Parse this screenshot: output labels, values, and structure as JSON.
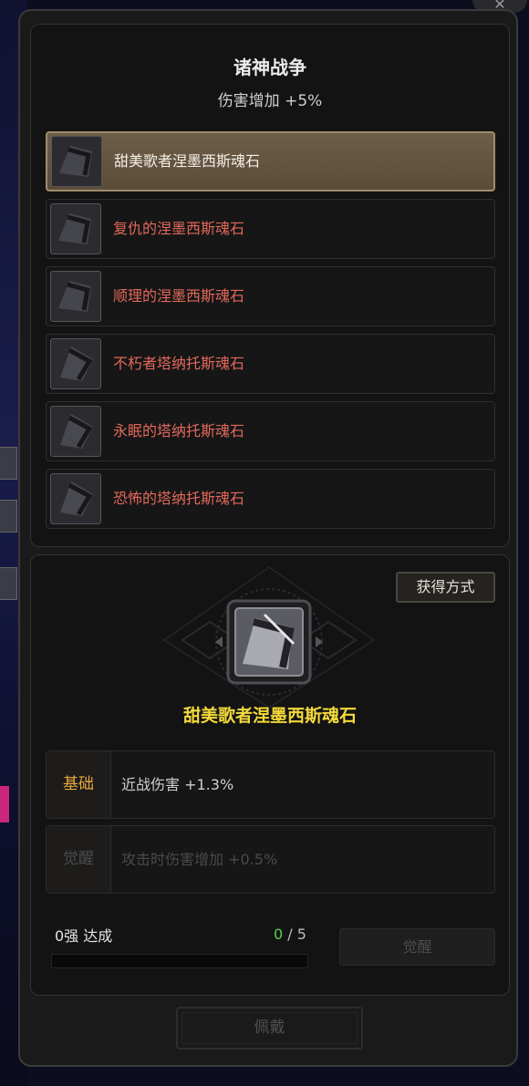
{
  "colors": {
    "selected_row": "#6e5d47",
    "locked_stone_text": "#e2685a",
    "stone_name_highlight": "#f3d93a",
    "base_tag": "#e4a640",
    "progress_current": "#5ad14f"
  },
  "set": {
    "title": "诸神战争",
    "bonus": "伤害增加 +5%"
  },
  "stones": [
    {
      "name": "甜美歌者涅墨西斯魂石",
      "selected": true,
      "icon": "soulstone-icon"
    },
    {
      "name": "复仇的涅墨西斯魂石",
      "selected": false,
      "icon": "soulstone-icon"
    },
    {
      "name": "顺理的涅墨西斯魂石",
      "selected": false,
      "icon": "soulstone-icon"
    },
    {
      "name": "不朽者塔纳托斯魂石",
      "selected": false,
      "icon": "soulstone-icon"
    },
    {
      "name": "永眠的塔纳托斯魂石",
      "selected": false,
      "icon": "soulstone-icon"
    },
    {
      "name": "恐怖的塔纳托斯魂石",
      "selected": false,
      "icon": "soulstone-icon"
    }
  ],
  "detail": {
    "acquire_button": "获得方式",
    "selected_name": "甜美歌者涅墨西斯魂石",
    "base_tag": "基础",
    "base_value": "近战伤害 +1.3%",
    "awaken_tag": "觉醒",
    "awaken_value": "攻击时伤害增加 +0.5%"
  },
  "progress": {
    "label": "0强 达成",
    "current": "0",
    "separator": " / ",
    "max": "5",
    "fraction": 0
  },
  "buttons": {
    "awaken": "觉醒",
    "equip": "佩戴"
  }
}
